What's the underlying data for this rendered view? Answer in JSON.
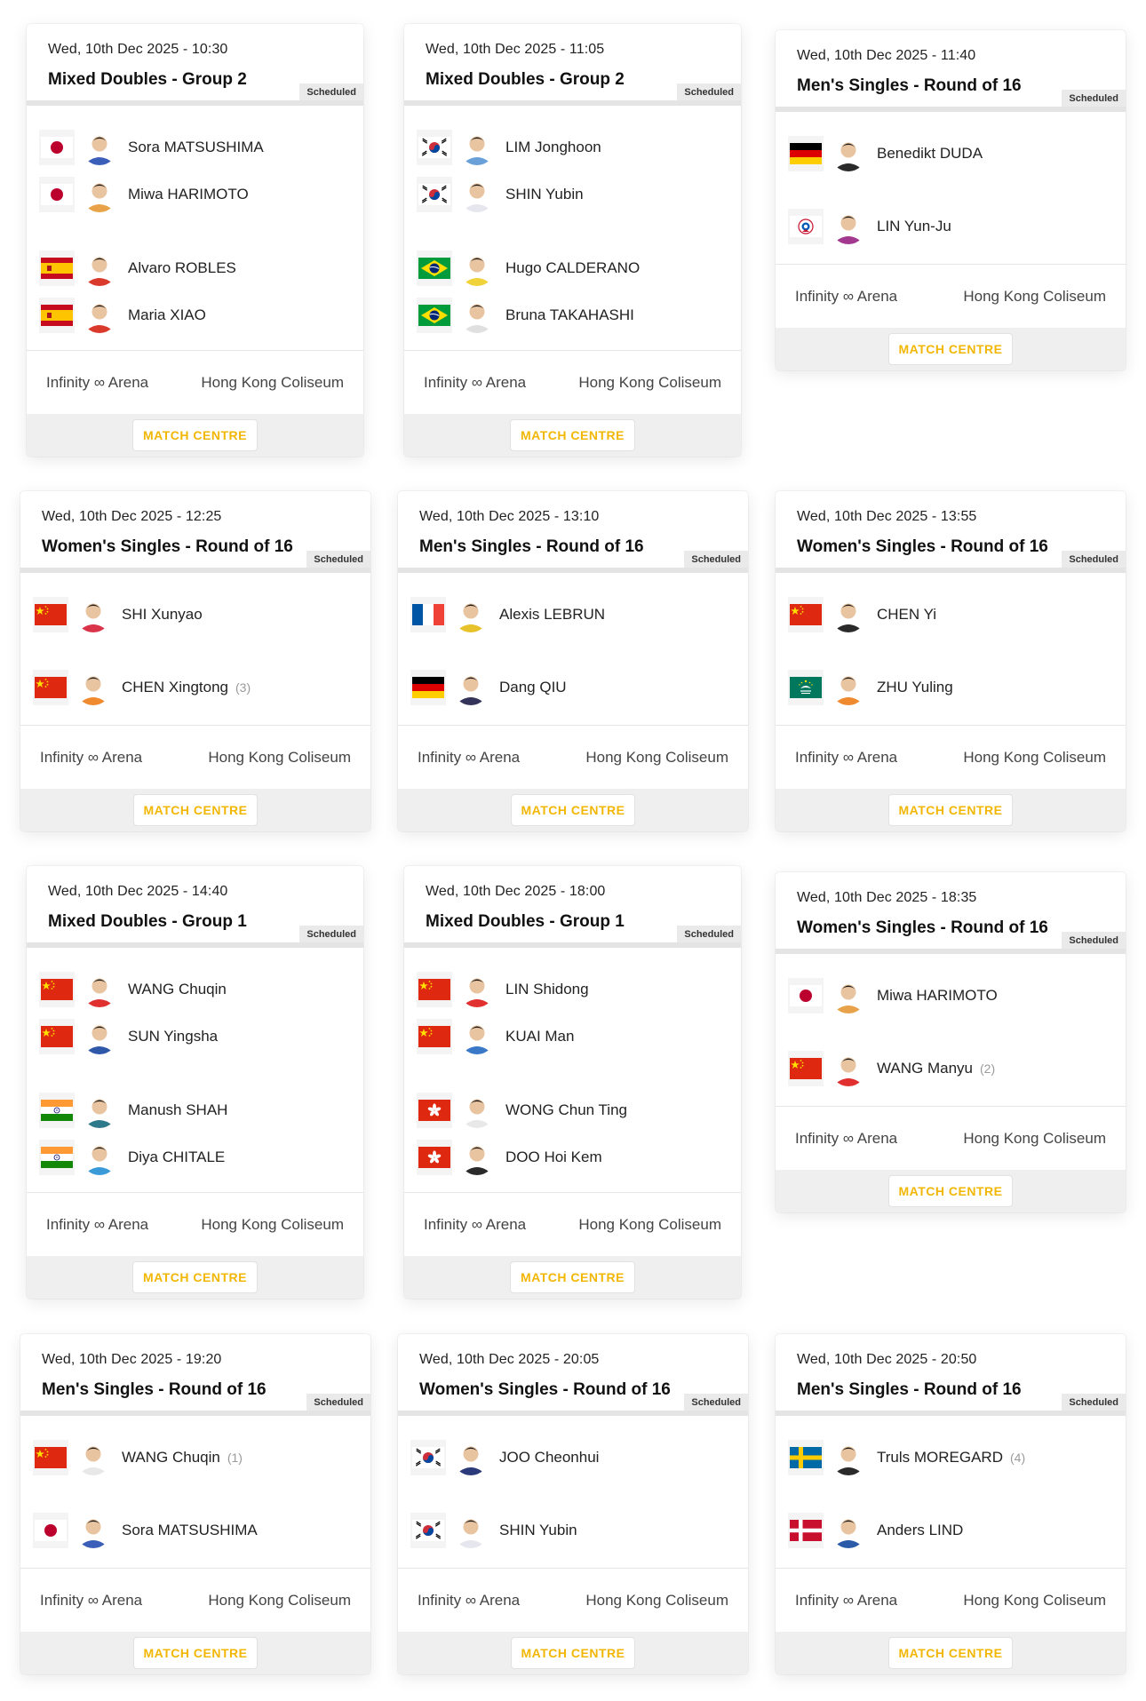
{
  "colors": {
    "accent": "#f2b705",
    "status_bg": "#eaeaea",
    "footer_bg": "#efefef"
  },
  "matches": [
    {
      "datetime": "Wed, 10th Dec 2025 - 10:30",
      "event": "Mixed Doubles - Group 2",
      "status": "Scheduled",
      "players": [
        {
          "flag": "japan-flag",
          "name": "Sora MATSUSHIMA",
          "seed": "",
          "avatar": "#3b5fb8"
        },
        {
          "flag": "japan-flag",
          "name": "Miwa HARIMOTO",
          "seed": "",
          "avatar": "#e8a24a"
        },
        {
          "flag": "spain-flag",
          "name": "Alvaro ROBLES",
          "seed": "",
          "avatar": "#d93a2b"
        },
        {
          "flag": "spain-flag",
          "name": "Maria XIAO",
          "seed": "",
          "avatar": "#d93a2b"
        }
      ],
      "venues": [
        "Infinity ∞ Arena",
        "Hong Kong Coliseum"
      ],
      "button": "MATCH CENTRE"
    },
    {
      "datetime": "Wed, 10th Dec 2025 - 11:05",
      "event": "Mixed Doubles - Group 2",
      "status": "Scheduled",
      "players": [
        {
          "flag": "korea-flag",
          "name": "LIM Jonghoon",
          "seed": "",
          "avatar": "#6aa0d8"
        },
        {
          "flag": "korea-flag",
          "name": "SHIN Yubin",
          "seed": "",
          "avatar": "#e6e6ee"
        },
        {
          "flag": "brazil-flag",
          "name": "Hugo CALDERANO",
          "seed": "",
          "avatar": "#f0d23a"
        },
        {
          "flag": "brazil-flag",
          "name": "Bruna TAKAHASHI",
          "seed": "",
          "avatar": "#e0e0e0"
        }
      ],
      "venues": [
        "Infinity ∞ Arena",
        "Hong Kong Coliseum"
      ],
      "button": "MATCH CENTRE"
    },
    {
      "datetime": "Wed, 10th Dec 2025 - 11:40",
      "event": "Men's Singles - Round of 16",
      "status": "Scheduled",
      "players": [
        {
          "flag": "germany-flag",
          "name": "Benedikt DUDA",
          "seed": "",
          "avatar": "#2a2a2a"
        },
        {
          "flag": "chinese-taipei-flag",
          "name": "LIN Yun-Ju",
          "seed": "",
          "avatar": "#a3388f"
        }
      ],
      "venues": [
        "Infinity ∞ Arena",
        "Hong Kong Coliseum"
      ],
      "button": "MATCH CENTRE"
    },
    {
      "datetime": "Wed, 10th Dec 2025 - 12:25",
      "event": "Women's Singles - Round of 16",
      "status": "Scheduled",
      "players": [
        {
          "flag": "china-flag",
          "name": "SHI Xunyao",
          "seed": "",
          "avatar": "#d9344a"
        },
        {
          "flag": "china-flag",
          "name": "CHEN Xingtong",
          "seed": "(3)",
          "avatar": "#f08a2e"
        }
      ],
      "venues": [
        "Infinity ∞ Arena",
        "Hong Kong Coliseum"
      ],
      "button": "MATCH CENTRE"
    },
    {
      "datetime": "Wed, 10th Dec 2025 - 13:10",
      "event": "Men's Singles - Round of 16",
      "status": "Scheduled",
      "players": [
        {
          "flag": "france-flag",
          "name": "Alexis LEBRUN",
          "seed": "",
          "avatar": "#e8c22a"
        },
        {
          "flag": "germany-flag",
          "name": "Dang QIU",
          "seed": "",
          "avatar": "#34345a"
        }
      ],
      "venues": [
        "Infinity ∞ Arena",
        "Hong Kong Coliseum"
      ],
      "button": "MATCH CENTRE"
    },
    {
      "datetime": "Wed, 10th Dec 2025 - 13:55",
      "event": "Women's Singles - Round of 16",
      "status": "Scheduled",
      "players": [
        {
          "flag": "china-flag",
          "name": "CHEN Yi",
          "seed": "",
          "avatar": "#2a2a2a"
        },
        {
          "flag": "macao-flag",
          "name": "ZHU Yuling",
          "seed": "",
          "avatar": "#f08a2e"
        }
      ],
      "venues": [
        "Infinity ∞ Arena",
        "Hong Kong Coliseum"
      ],
      "button": "MATCH CENTRE"
    },
    {
      "datetime": "Wed, 10th Dec 2025 - 14:40",
      "event": "Mixed Doubles - Group 1",
      "status": "Scheduled",
      "players": [
        {
          "flag": "china-flag",
          "name": "WANG Chuqin",
          "seed": "",
          "avatar": "#e03030"
        },
        {
          "flag": "china-flag",
          "name": "SUN Yingsha",
          "seed": "",
          "avatar": "#3058a8"
        },
        {
          "flag": "india-flag",
          "name": "Manush SHAH",
          "seed": "",
          "avatar": "#2e7a8a"
        },
        {
          "flag": "india-flag",
          "name": "Diya CHITALE",
          "seed": "",
          "avatar": "#3a9ad8"
        }
      ],
      "venues": [
        "Infinity ∞ Arena",
        "Hong Kong Coliseum"
      ],
      "button": "MATCH CENTRE"
    },
    {
      "datetime": "Wed, 10th Dec 2025 - 18:00",
      "event": "Mixed Doubles - Group 1",
      "status": "Scheduled",
      "players": [
        {
          "flag": "china-flag",
          "name": "LIN Shidong",
          "seed": "",
          "avatar": "#e03030"
        },
        {
          "flag": "china-flag",
          "name": "KUAI Man",
          "seed": "",
          "avatar": "#3a78c8"
        },
        {
          "flag": "hong-kong-flag",
          "name": "WONG Chun Ting",
          "seed": "",
          "avatar": "#e8e8e8"
        },
        {
          "flag": "hong-kong-flag",
          "name": "DOO Hoi Kem",
          "seed": "",
          "avatar": "#2a2a2a"
        }
      ],
      "venues": [
        "Infinity ∞ Arena",
        "Hong Kong Coliseum"
      ],
      "button": "MATCH CENTRE"
    },
    {
      "datetime": "Wed, 10th Dec 2025 - 18:35",
      "event": "Women's Singles - Round of 16",
      "status": "Scheduled",
      "players": [
        {
          "flag": "japan-flag",
          "name": "Miwa HARIMOTO",
          "seed": "",
          "avatar": "#e8a24a"
        },
        {
          "flag": "china-flag",
          "name": "WANG Manyu",
          "seed": "(2)",
          "avatar": "#e03030"
        }
      ],
      "venues": [
        "Infinity ∞ Arena",
        "Hong Kong Coliseum"
      ],
      "button": "MATCH CENTRE"
    },
    {
      "datetime": "Wed, 10th Dec 2025 - 19:20",
      "event": "Men's Singles - Round of 16",
      "status": "Scheduled",
      "players": [
        {
          "flag": "china-flag",
          "name": "WANG Chuqin",
          "seed": "(1)",
          "avatar": "#e8e8e8"
        },
        {
          "flag": "japan-flag",
          "name": "Sora MATSUSHIMA",
          "seed": "",
          "avatar": "#3b5fb8"
        }
      ],
      "venues": [
        "Infinity ∞ Arena",
        "Hong Kong Coliseum"
      ],
      "button": "MATCH CENTRE"
    },
    {
      "datetime": "Wed, 10th Dec 2025 - 20:05",
      "event": "Women's Singles - Round of 16",
      "status": "Scheduled",
      "players": [
        {
          "flag": "korea-flag",
          "name": "JOO Cheonhui",
          "seed": "",
          "avatar": "#2a3a7a"
        },
        {
          "flag": "korea-flag",
          "name": "SHIN Yubin",
          "seed": "",
          "avatar": "#e6e6ee"
        }
      ],
      "venues": [
        "Infinity ∞ Arena",
        "Hong Kong Coliseum"
      ],
      "button": "MATCH CENTRE"
    },
    {
      "datetime": "Wed, 10th Dec 2025 - 20:50",
      "event": "Men's Singles - Round of 16",
      "status": "Scheduled",
      "players": [
        {
          "flag": "sweden-flag",
          "name": "Truls MOREGARD",
          "seed": "(4)",
          "avatar": "#2a2a2a"
        },
        {
          "flag": "denmark-flag",
          "name": "Anders LIND",
          "seed": "",
          "avatar": "#2a5aa8"
        }
      ],
      "venues": [
        "Infinity ∞ Arena",
        "Hong Kong Coliseum"
      ],
      "button": "MATCH CENTRE"
    }
  ]
}
